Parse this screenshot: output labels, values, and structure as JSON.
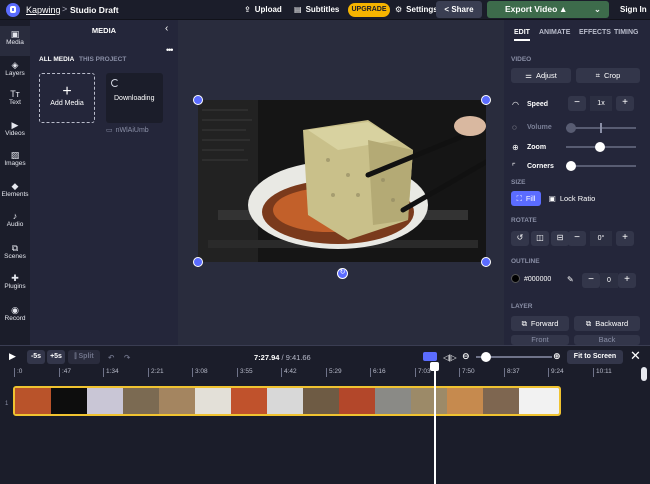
{
  "header": {
    "brand": "Kapwing",
    "separator": ">",
    "project_title": "Studio Draft",
    "upload_label": "Upload",
    "subtitles_label": "Subtitles",
    "upgrade_label": "UPGRADE",
    "settings_label": "Settings",
    "share_label": "Share",
    "export_label": "Export Video",
    "signin_label": "Sign In"
  },
  "left_nav": {
    "items": [
      {
        "label": "Media",
        "icon": "media-icon",
        "glyph": "▣"
      },
      {
        "label": "Layers",
        "icon": "layers-icon",
        "glyph": "◈"
      },
      {
        "label": "Text",
        "icon": "text-icon",
        "glyph": "Tт"
      },
      {
        "label": "Videos",
        "icon": "videos-icon",
        "glyph": "▶"
      },
      {
        "label": "Images",
        "icon": "images-icon",
        "glyph": "▨"
      },
      {
        "label": "Elements",
        "icon": "elements-icon",
        "glyph": "◆"
      },
      {
        "label": "Audio",
        "icon": "audio-icon",
        "glyph": "♪"
      },
      {
        "label": "Scenes",
        "icon": "scenes-icon",
        "glyph": "⧉"
      },
      {
        "label": "Plugins",
        "icon": "plugins-icon",
        "glyph": "✚"
      },
      {
        "label": "Record",
        "icon": "record-icon",
        "glyph": "◉"
      }
    ]
  },
  "media_panel": {
    "title": "MEDIA",
    "tabs": [
      "ALL MEDIA",
      "THIS PROJECT"
    ],
    "add_media_label": "Add Media",
    "downloading_label": "Downloading",
    "file_name": "nWlAiUmb"
  },
  "right_panel": {
    "tabs": [
      "EDIT",
      "ANIMATE",
      "EFFECTS",
      "TIMING"
    ],
    "video_section": "VIDEO",
    "adjust_label": "Adjust",
    "crop_label": "Crop",
    "speed_label": "Speed",
    "speed_value": "1x",
    "volume_label": "Volume",
    "zoom_label": "Zoom",
    "corners_label": "Corners",
    "size_section": "SIZE",
    "fill_label": "Fill",
    "lock_ratio_label": "Lock Ratio",
    "rotate_section": "ROTATE",
    "outline_section": "OUTLINE",
    "outline_color": "#000000",
    "outline_width": "0",
    "layer_section": "LAYER",
    "forward_label": "Forward",
    "backward_label": "Backward",
    "front_label": "Front",
    "back_label": "Back"
  },
  "timeline": {
    "skip_back_label": "-5s",
    "skip_fwd_label": "+5s",
    "split_label": "Split",
    "current_time": "7:27.94",
    "total_time": "/ 9:41.66",
    "fit_label": "Fit to Screen",
    "ticks": [
      ":0",
      ":47",
      "1:34",
      "2:21",
      "3:08",
      "3:55",
      "4:42",
      "5:29",
      "6:16",
      "7:03",
      "7:50",
      "8:37",
      "9:24",
      "10:11"
    ],
    "track_number": "1"
  },
  "colors": {
    "accent": "#5b6cff",
    "upgrade": "#f5b400",
    "export": "#3d6b4b",
    "clip_border": "#f0c330"
  }
}
